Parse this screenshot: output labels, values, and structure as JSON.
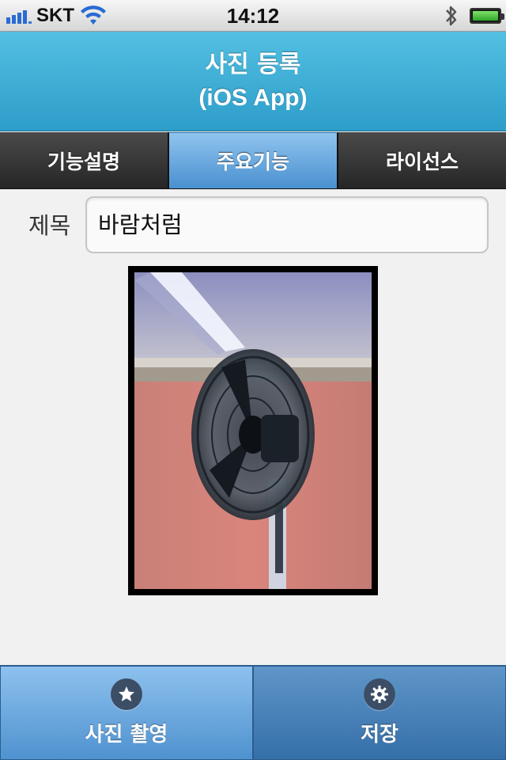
{
  "status_bar": {
    "carrier": "SKT",
    "time": "14:12",
    "icons": [
      "signal-icon",
      "wifi-icon",
      "bluetooth-icon",
      "battery-charging-icon"
    ]
  },
  "header": {
    "title": "사진 등록",
    "subtitle": "(iOS App)"
  },
  "tabs": [
    {
      "label": "기능설명",
      "active": false
    },
    {
      "label": "주요기능",
      "active": true
    },
    {
      "label": "라이선스",
      "active": false
    }
  ],
  "form": {
    "title_label": "제목",
    "title_value": "바람처럼"
  },
  "toolbar": {
    "take_photo_label": "사진 촬영",
    "take_photo_icon": "star-icon",
    "save_label": "저장",
    "save_icon": "gear-icon"
  },
  "colors": {
    "header_accent": "#3fb0d8",
    "active_tab": "#6aa8e0",
    "toolbar_primary": "#6aa6de",
    "toolbar_secondary": "#4a84bc"
  }
}
